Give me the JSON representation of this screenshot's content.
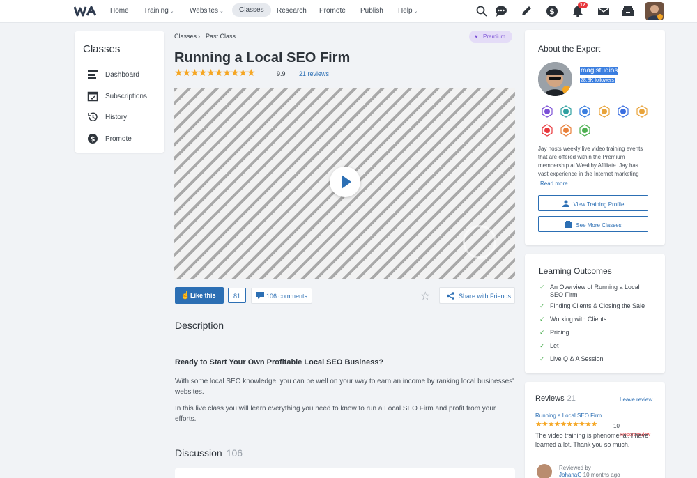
{
  "nav": {
    "items": [
      {
        "label": "Home"
      },
      {
        "label": "Training",
        "dropdown": true
      },
      {
        "label": "Websites",
        "dropdown": true
      },
      {
        "label": "Classes",
        "active": true
      },
      {
        "label": "Research"
      },
      {
        "label": "Promote"
      },
      {
        "label": "Publish"
      },
      {
        "label": "Help",
        "dropdown": true
      }
    ],
    "caret": "⌄",
    "notification_count": "12",
    "icons": [
      "search-icon",
      "chat-icon",
      "pen-icon",
      "dollar-icon",
      "bell-icon",
      "mail-icon",
      "inbox-icon",
      "avatar"
    ]
  },
  "sidebar": {
    "title": "Classes",
    "items": [
      {
        "label": "Dashboard",
        "icon": "dashboard-icon"
      },
      {
        "label": "Subscriptions",
        "icon": "calendar-check-icon"
      },
      {
        "label": "History",
        "icon": "history-icon"
      },
      {
        "label": "Promote",
        "icon": "dollar-coin-icon"
      }
    ]
  },
  "breadcrumb": {
    "items": [
      "Classes",
      "Past Class"
    ],
    "separator": "›"
  },
  "premium_badge": "Premium",
  "class": {
    "title": "Running a Local SEO Firm",
    "stars": "★★★★★★★★★★",
    "rating": "9.9",
    "reviews_link": "21 reviews"
  },
  "actions": {
    "like_label": "Like this",
    "like_count": "81",
    "comments_label": "106 comments",
    "share_label": "Share with Friends"
  },
  "description": {
    "heading": "Description",
    "subheading": "Ready to Start Your Own Profitable Local SEO Business?",
    "paragraphs": [
      "With some local SEO knowledge, you can be well on your way to earn an income by ranking local businesses' websites.",
      "In this live class you will learn everything you need to know to run a Local SEO Firm and profit from your efforts."
    ]
  },
  "discussion": {
    "heading": "Discussion",
    "count": "106"
  },
  "expert": {
    "heading": "About the Expert",
    "name": "magistudios",
    "followers": "28.8K followers",
    "bio": "Jay hosts weekly live video training events that are offered within the Premium membership at Wealthy Affiliate. Jay has vast experience in the Internet marketing",
    "read_more": "Read more",
    "view_profile": "View Training Profile",
    "see_more": "See More Classes",
    "achievements": [
      {
        "name": "heart-gem-achievement",
        "color": "#7b4fd6"
      },
      {
        "name": "user-achievement",
        "color": "#2fa0a0"
      },
      {
        "name": "year-2007-achievement",
        "color": "#3a7ee0"
      },
      {
        "name": "google-achievement",
        "color": "#e8a33a"
      },
      {
        "name": "chat-achievement",
        "color": "#3a6ee0"
      },
      {
        "name": "medal-achievement",
        "color": "#e8a33a"
      },
      {
        "name": "heart-achievement",
        "color": "#e8383d"
      },
      {
        "name": "flag-achievement",
        "color": "#e8803a"
      },
      {
        "name": "bookmark-achievement",
        "color": "#4caf50"
      }
    ]
  },
  "outcomes": {
    "heading": "Learning Outcomes",
    "items": [
      "An Overview of Running a Local SEO Firm",
      "Finding Clients & Closing the Sale",
      "Working with Clients",
      "Pricing",
      "Let",
      "Live Q & A Session"
    ]
  },
  "reviews": {
    "heading": "Reviews",
    "count": "21",
    "leave": "Leave review",
    "item": {
      "title": "Running a Local SEO Firm",
      "stars": "★★★★★★★★★★",
      "score": "10",
      "report": "Report review",
      "text": "The video training is phenomenal. I have learned a lot. Thank you so much.",
      "reviewed_by": "Reviewed by",
      "author": "JohanaG",
      "when": "10 months ago"
    }
  },
  "colors": {
    "accent": "#2c6fb4",
    "star": "#f5a623",
    "premium": "#7a4fd6",
    "success": "#4caf50"
  }
}
